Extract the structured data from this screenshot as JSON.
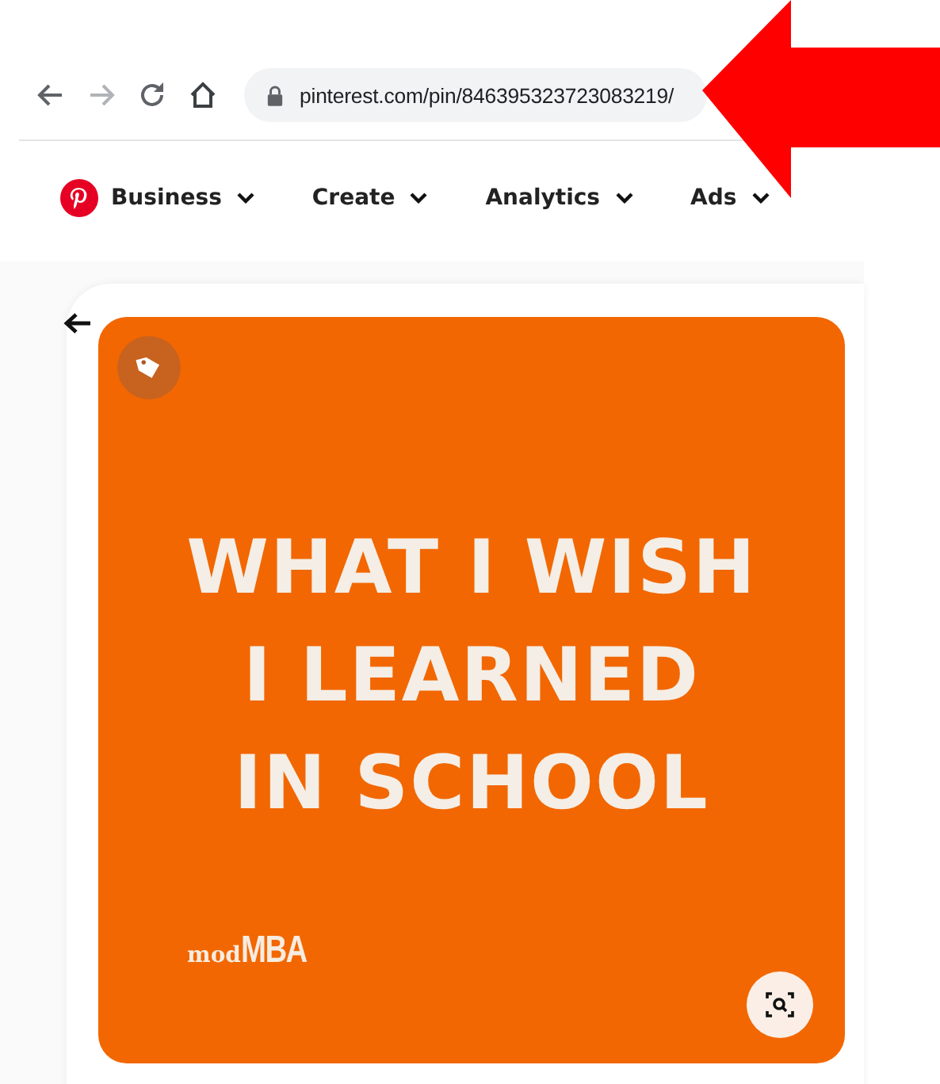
{
  "browser": {
    "url": "pinterest.com/pin/846395323723083219/"
  },
  "nav": {
    "items": [
      {
        "label": "Business"
      },
      {
        "label": "Create"
      },
      {
        "label": "Analytics"
      },
      {
        "label": "Ads"
      }
    ]
  },
  "pin": {
    "headline": [
      "WHAT I WISH",
      "I LEARNED",
      "IN SCHOOL"
    ],
    "logo": {
      "prefix": "mod",
      "main": "MBA"
    }
  }
}
